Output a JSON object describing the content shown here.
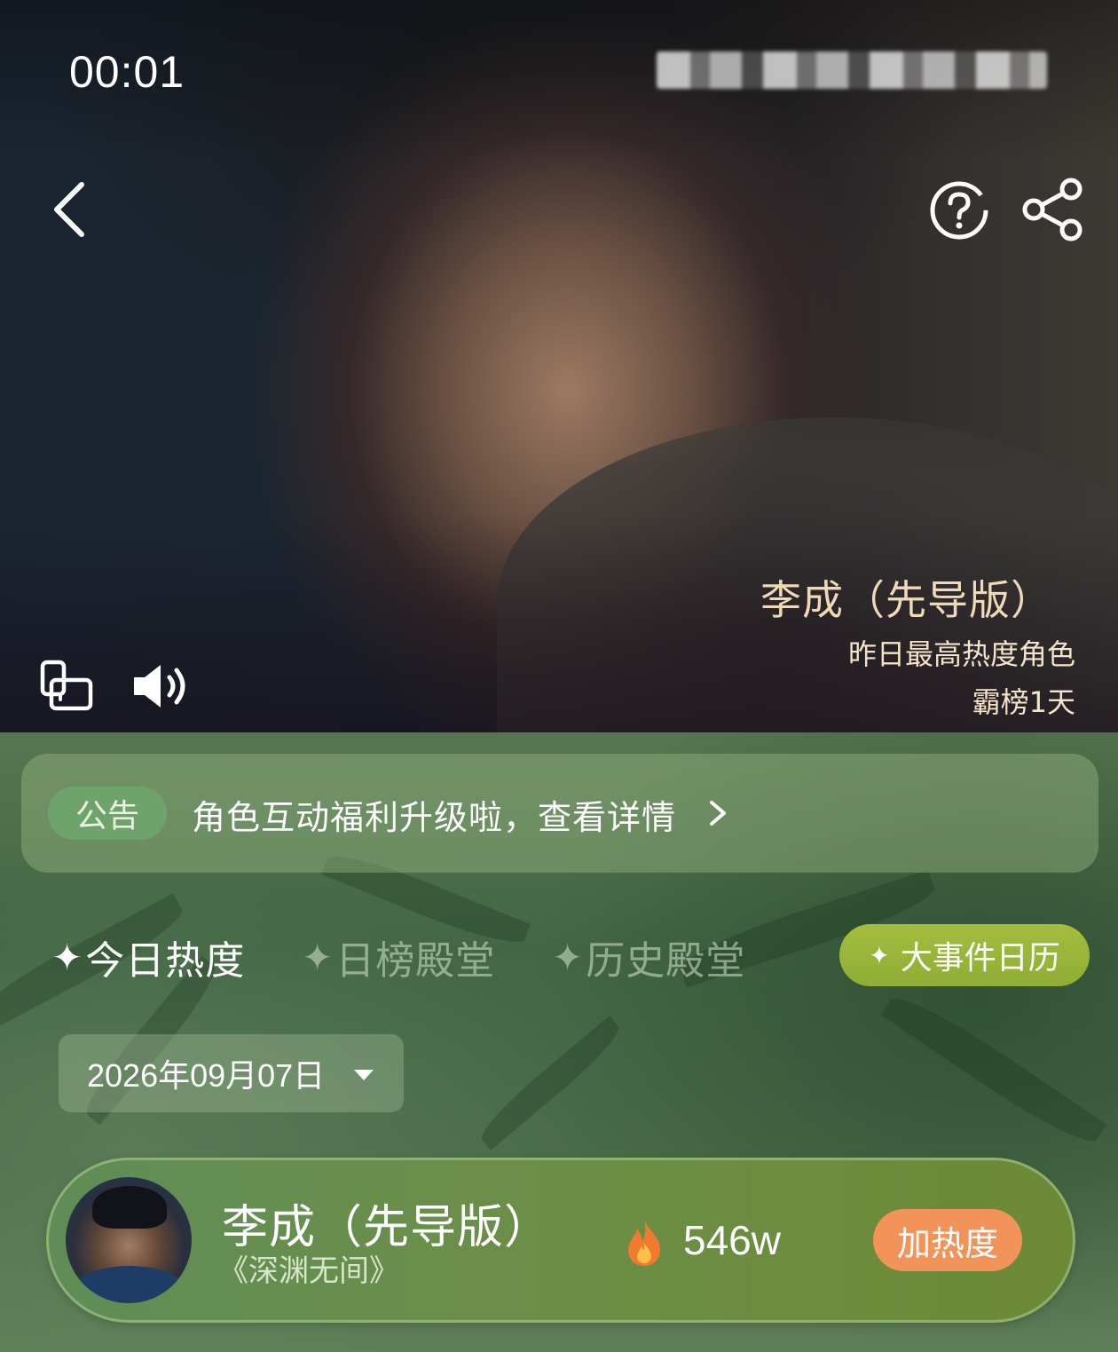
{
  "status_bar": {
    "time": "00:01"
  },
  "hero": {
    "title": "李成（先导版）",
    "subtitle": "昨日最高热度角色",
    "streak": "霸榜1天"
  },
  "icons": {
    "back": "back-chevron-icon",
    "help": "question-circle-icon",
    "share": "share-icon",
    "rotate": "rotate-screen-icon",
    "volume": "volume-icon",
    "notice_arrow": "chevron-right-icon",
    "date_caret": "caret-down-icon",
    "fire": "fire-icon",
    "star": "sparkle-icon"
  },
  "notice": {
    "tag": "公告",
    "text": "角色互动福利升级啦，查看详情"
  },
  "tabs": [
    {
      "star": "✦",
      "label": "今日热度",
      "active": true
    },
    {
      "star": "✦",
      "label": "日榜殿堂",
      "active": false
    },
    {
      "star": "✦",
      "label": "历史殿堂",
      "active": false
    }
  ],
  "events_button": {
    "star": "✦",
    "label": "大事件日历"
  },
  "date_picker": {
    "value": "2026年09月07日"
  },
  "ranking": [
    {
      "name": "李成（先导版）",
      "drama": "《深渊无间》",
      "heat": "546w",
      "action": "加热度"
    }
  ],
  "colors": {
    "green_bg": "#436744",
    "notice_tag": "#6ea36b",
    "events_button": "#9bb83c",
    "heat_button": "#f2935a",
    "hero_title": "#f0d9b6"
  }
}
